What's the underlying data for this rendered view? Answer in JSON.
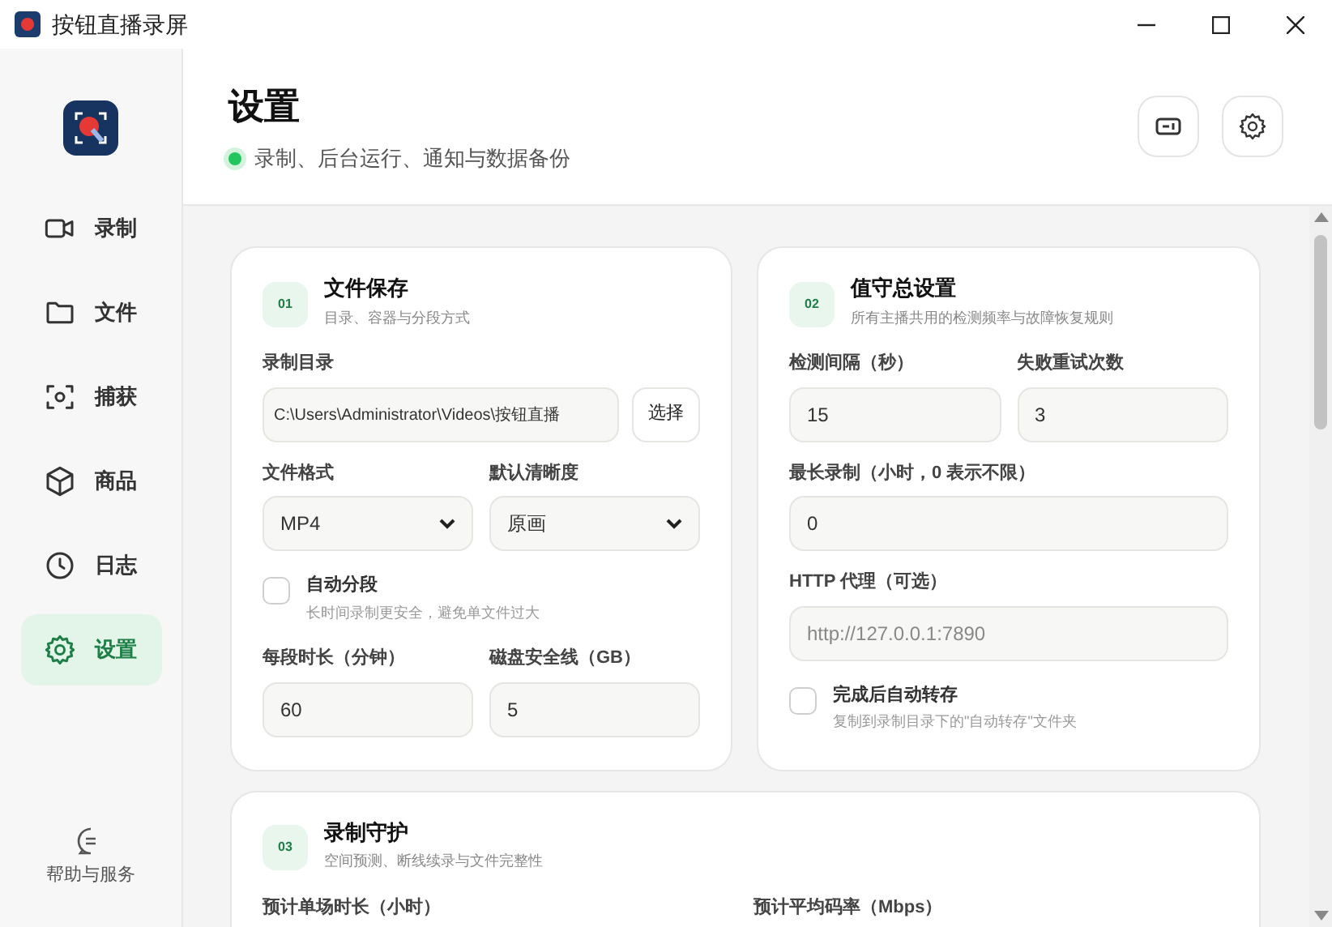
{
  "window": {
    "title": "按钮直播录屏"
  },
  "sidebar": {
    "items": [
      {
        "label": "录制",
        "selected": false
      },
      {
        "label": "文件",
        "selected": false
      },
      {
        "label": "捕获",
        "selected": false
      },
      {
        "label": "商品",
        "selected": false
      },
      {
        "label": "日志",
        "selected": false
      },
      {
        "label": "设置",
        "selected": true
      }
    ],
    "help": "帮助与服务"
  },
  "header": {
    "title": "设置",
    "subtitle": "录制、后台运行、通知与数据备份"
  },
  "cards": [
    {
      "number": "01",
      "title": "文件保存",
      "subtitle": "目录、容器与分段方式",
      "rows": [
        [
          {
            "kind": "path",
            "label": "录制目录",
            "value": "C:\\Users\\Administrator\\Videos\\按钮直播",
            "button": "选择"
          }
        ],
        [
          {
            "kind": "select",
            "label": "文件格式",
            "value": "MP4"
          },
          {
            "kind": "select",
            "label": "默认清晰度",
            "value": "原画"
          }
        ],
        [
          {
            "kind": "checkbox",
            "label": "自动分段",
            "hint": "长时间录制更安全，避免单文件过大",
            "checked": false
          }
        ],
        [
          {
            "kind": "input",
            "label": "每段时长（分钟）",
            "value": "60"
          },
          {
            "kind": "input",
            "label": "磁盘安全线（GB）",
            "value": "5"
          }
        ]
      ]
    },
    {
      "number": "02",
      "title": "值守总设置",
      "subtitle": "所有主播共用的检测频率与故障恢复规则",
      "rows": [
        [
          {
            "kind": "input",
            "label": "检测间隔（秒）",
            "value": "15"
          },
          {
            "kind": "input",
            "label": "失败重试次数",
            "value": "3"
          }
        ],
        [
          {
            "kind": "input",
            "label": "最长录制（小时，0 表示不限）",
            "value": "0"
          }
        ],
        [
          {
            "kind": "input",
            "label": "HTTP 代理（可选）",
            "placeholder": "http://127.0.0.1:7890"
          }
        ],
        [
          {
            "kind": "checkbox",
            "label": "完成后自动转存",
            "hint": "复制到录制目录下的\"自动转存\"文件夹",
            "checked": false
          }
        ]
      ]
    },
    {
      "number": "03",
      "title": "录制守护",
      "subtitle": "空间预测、断线续录与文件完整性",
      "rows": [
        [
          {
            "kind": "input",
            "label": "预计单场时长（小时）"
          },
          {
            "kind": "input",
            "label": "预计平均码率（Mbps）"
          }
        ]
      ]
    }
  ]
}
